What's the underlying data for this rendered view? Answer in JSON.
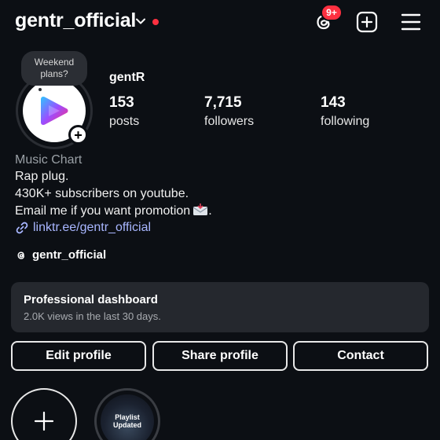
{
  "header": {
    "username": "gentr_official",
    "notification_badge": "9+",
    "icons": {
      "dropdown": "chevron-down-icon",
      "threads": "threads-icon",
      "create": "plus-square-icon",
      "menu": "hamburger-menu-icon"
    },
    "colors": {
      "badge": "#ff3040",
      "background": "#0c0f14"
    }
  },
  "note": {
    "text_line1": "Weekend",
    "text_line2": "plans?"
  },
  "profile": {
    "display_name": "gentR",
    "avatar_icon": "play-logo-icon",
    "stats": [
      {
        "value": "153",
        "label": "posts"
      },
      {
        "value": "7,715",
        "label": "followers"
      },
      {
        "value": "143",
        "label": "following"
      }
    ]
  },
  "bio": {
    "category": "Music Chart",
    "lines": [
      "Rap plug.",
      "430K+ subscribers on youtube.",
      "Email me if you want promotion"
    ],
    "mail_icon": "incoming-envelope-icon",
    "link": "linktr.ee/gentr_official",
    "link_color": "#a8b6ff",
    "threads_handle": "gentr_official"
  },
  "dashboard": {
    "title": "Professional dashboard",
    "subtitle": "2.0K views in the last 30 days."
  },
  "actions": {
    "edit": "Edit profile",
    "share": "Share profile",
    "contact": "Contact"
  },
  "highlights": {
    "new_icon": "plus-icon",
    "story_line1": "Playlist",
    "story_line2": "Updated"
  }
}
